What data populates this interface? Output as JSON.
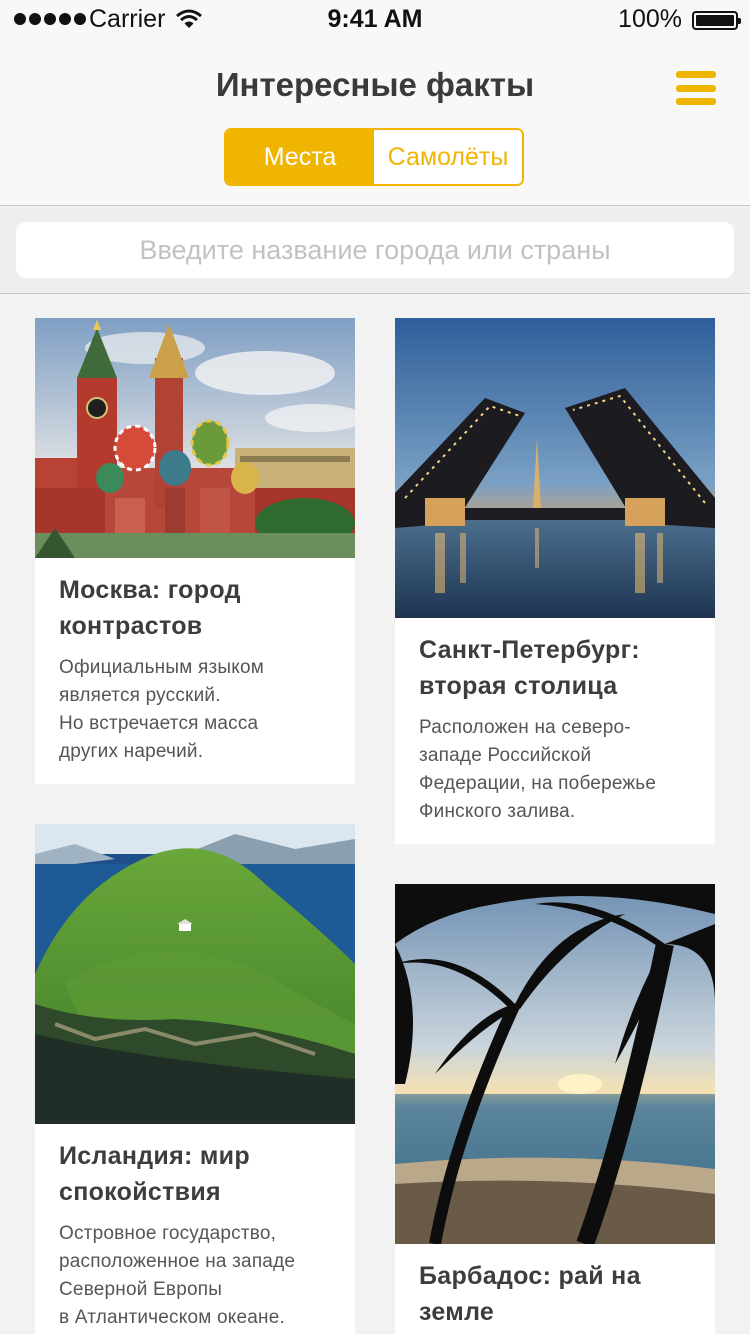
{
  "status_bar": {
    "carrier": "Carrier",
    "time": "9:41 AM",
    "battery": "100%"
  },
  "header": {
    "title": "Интересные факты",
    "tabs": [
      {
        "label": "Места",
        "active": true
      },
      {
        "label": "Самолёты",
        "active": false
      }
    ],
    "menu_icon": "hamburger-menu-icon"
  },
  "search": {
    "placeholder": "Введите название города или страны",
    "value": ""
  },
  "colors": {
    "accent": "#f0b500",
    "background": "#f2f2f2"
  },
  "cards": [
    {
      "title": "Москва: город контрастов",
      "text": [
        "Официальным языком",
        "является русский.",
        "Но встречается масса",
        "других наречий."
      ]
    },
    {
      "title": "Санкт-Петербург: вторая столица",
      "text": [
        "Расположен на северо-",
        "западе Российской",
        "Федерации, на побережье",
        "Финского залива."
      ]
    },
    {
      "title": "Исландия: мир спокойствия",
      "text": [
        "Островное государство,",
        "расположенное на западе",
        "Северной Европы",
        "в Атлантическом океане."
      ]
    },
    {
      "title": "Барбадос: рай на земле",
      "text": []
    }
  ]
}
